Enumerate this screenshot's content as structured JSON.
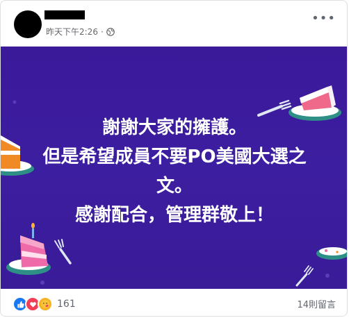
{
  "post": {
    "timestamp": "昨天下午2:26",
    "separator": "·",
    "privacy_icon": "globe-icon",
    "more_icon": "ellipsis-icon"
  },
  "banner": {
    "lines": [
      "謝謝大家的擁護。",
      "但是希望成員不要PO美國大選之",
      "文。",
      "感謝配合，管理群敬上！"
    ],
    "background": "#3b1a9a",
    "text_color": "#ffffff"
  },
  "footer": {
    "reaction_icons": [
      "like-icon",
      "love-icon",
      "care-icon"
    ],
    "reaction_count": "161",
    "comment_count": "14則留言"
  }
}
